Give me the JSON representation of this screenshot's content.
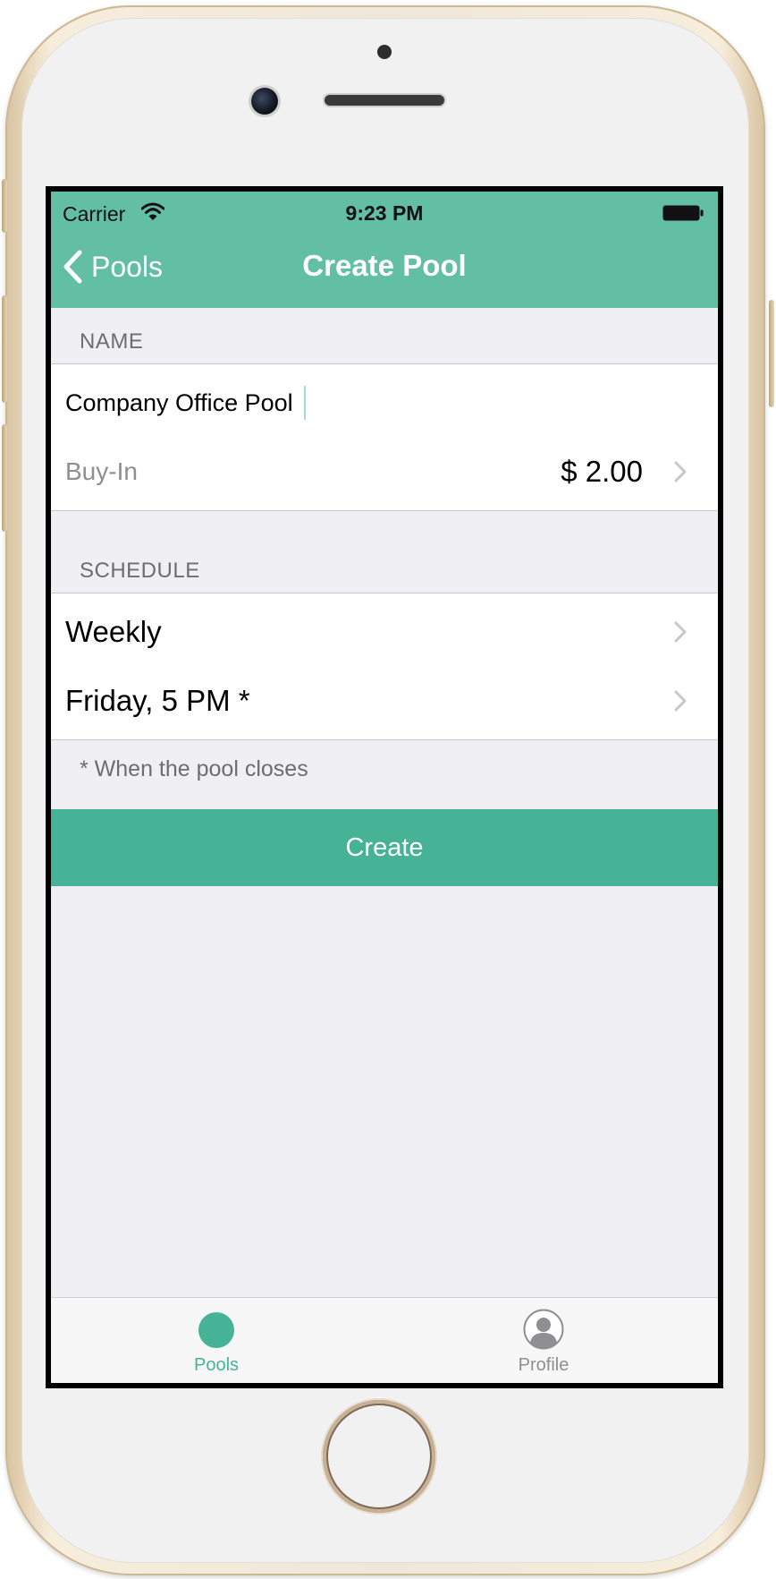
{
  "status_bar": {
    "carrier": "Carrier",
    "time": "9:23 PM",
    "wifi_icon": "wifi-icon",
    "battery_icon": "battery-icon"
  },
  "nav": {
    "back_label": "Pools",
    "back_icon": "chevron-left-icon",
    "title": "Create Pool",
    "bar_color": "#62bfa4"
  },
  "form": {
    "name_section_header": "NAME",
    "name_value": "Company Office Pool",
    "name_placeholder": "",
    "buyin_label": "Buy-In",
    "buyin_value": "$ 2.00",
    "schedule_section_header": "SCHEDULE",
    "frequency_value": "Weekly",
    "close_time_value": "Friday, 5 PM *",
    "footnote": "* When the pool closes"
  },
  "actions": {
    "create_label": "Create",
    "create_color": "#47b396"
  },
  "tabbar": {
    "tabs": [
      {
        "label": "Pools",
        "icon": "pools-dot-icon",
        "selected": true,
        "color": "#47b396"
      },
      {
        "label": "Profile",
        "icon": "profile-avatar-icon",
        "selected": false,
        "color": "#8e8e93"
      }
    ]
  }
}
